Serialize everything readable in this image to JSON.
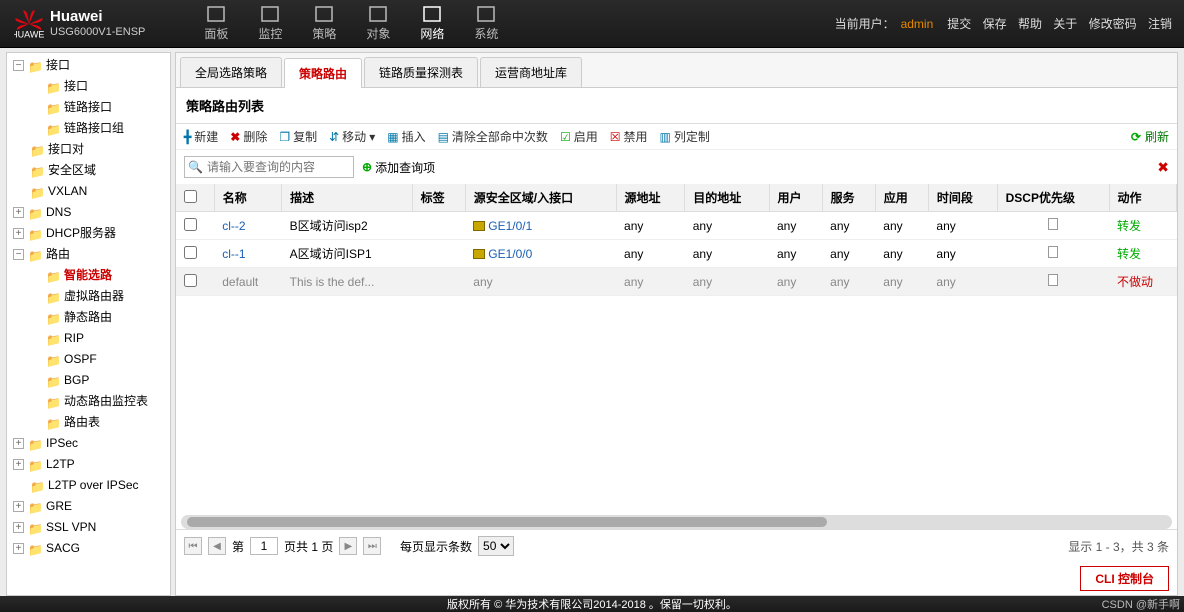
{
  "header": {
    "brand": "Huawei",
    "model": "USG6000V1-ENSP",
    "user_label": "当前用户：",
    "user_name": "admin",
    "links": [
      "提交",
      "保存",
      "帮助",
      "关于",
      "修改密码",
      "注销"
    ]
  },
  "topnav": [
    {
      "label": "面板"
    },
    {
      "label": "监控"
    },
    {
      "label": "策略"
    },
    {
      "label": "对象"
    },
    {
      "label": "网络",
      "active": true
    },
    {
      "label": "系统"
    }
  ],
  "sidebar": [
    {
      "label": "接口",
      "lvl": 1,
      "exp": "-"
    },
    {
      "label": "接口",
      "lvl": 2,
      "exp": ""
    },
    {
      "label": "链路接口",
      "lvl": 2,
      "exp": ""
    },
    {
      "label": "链路接口组",
      "lvl": 2,
      "exp": ""
    },
    {
      "label": "接口对",
      "lvl": 1,
      "exp": ""
    },
    {
      "label": "安全区域",
      "lvl": 1,
      "exp": ""
    },
    {
      "label": "VXLAN",
      "lvl": 1,
      "exp": ""
    },
    {
      "label": "DNS",
      "lvl": 1,
      "exp": "+"
    },
    {
      "label": "DHCP服务器",
      "lvl": 1,
      "exp": "+"
    },
    {
      "label": "路由",
      "lvl": 1,
      "exp": "-"
    },
    {
      "label": "智能选路",
      "lvl": 2,
      "exp": "",
      "sel": true
    },
    {
      "label": "虚拟路由器",
      "lvl": 2,
      "exp": ""
    },
    {
      "label": "静态路由",
      "lvl": 2,
      "exp": ""
    },
    {
      "label": "RIP",
      "lvl": 2,
      "exp": ""
    },
    {
      "label": "OSPF",
      "lvl": 2,
      "exp": ""
    },
    {
      "label": "BGP",
      "lvl": 2,
      "exp": ""
    },
    {
      "label": "动态路由监控表",
      "lvl": 2,
      "exp": ""
    },
    {
      "label": "路由表",
      "lvl": 2,
      "exp": ""
    },
    {
      "label": "IPSec",
      "lvl": 1,
      "exp": "+"
    },
    {
      "label": "L2TP",
      "lvl": 1,
      "exp": "+"
    },
    {
      "label": "L2TP over IPSec",
      "lvl": 1,
      "exp": ""
    },
    {
      "label": "GRE",
      "lvl": 1,
      "exp": "+"
    },
    {
      "label": "SSL VPN",
      "lvl": 1,
      "exp": "+"
    },
    {
      "label": "SACG",
      "lvl": 1,
      "exp": "+"
    }
  ],
  "subtabs": [
    {
      "label": "全局选路策略"
    },
    {
      "label": "策略路由",
      "active": true
    },
    {
      "label": "链路质量探测表"
    },
    {
      "label": "运营商地址库"
    }
  ],
  "panel_title": "策略路由列表",
  "toolbar": {
    "add": "新建",
    "del": "删除",
    "copy": "复制",
    "move": "移动",
    "insert": "插入",
    "clear": "清除全部命中次数",
    "enable": "启用",
    "disable": "禁用",
    "cols": "列定制",
    "refresh": "刷新"
  },
  "search": {
    "placeholder": "请输入要查询的内容",
    "addq": "添加查询项"
  },
  "columns": [
    "",
    "名称",
    "描述",
    "标签",
    "源安全区域/入接口",
    "源地址",
    "目的地址",
    "用户",
    "服务",
    "应用",
    "时间段",
    "DSCP优先级",
    "动作"
  ],
  "rows": [
    {
      "name": "cl--2",
      "desc": "B区域访问isp2",
      "tag": "",
      "zone": "GE1/0/1",
      "src": "any",
      "dst": "any",
      "user": "any",
      "svc": "any",
      "app": "any",
      "time": "any",
      "dscp": "",
      "action": "转发",
      "cls": "fwd"
    },
    {
      "name": "cl--1",
      "desc": "A区域访问ISP1",
      "tag": "",
      "zone": "GE1/0/0",
      "src": "any",
      "dst": "any",
      "user": "any",
      "svc": "any",
      "app": "any",
      "time": "any",
      "dscp": "",
      "action": "转发",
      "cls": "fwd"
    },
    {
      "name": "default",
      "desc": "This is the def...",
      "tag": "",
      "zone": "any",
      "src": "any",
      "dst": "any",
      "user": "any",
      "svc": "any",
      "app": "any",
      "time": "any",
      "dscp": "",
      "action": "不做动",
      "cls": "nofwd",
      "def": true
    }
  ],
  "pager": {
    "page_label": "第",
    "page": "1",
    "total_pages": "页共 1 页",
    "perpage_label": "每页显示条数",
    "perpage": "50",
    "info": "显示 1 - 3，共 3 条"
  },
  "cli": "CLI 控制台",
  "footer": "版权所有 © 华为技术有限公司2014-2018 。保留一切权利。",
  "watermark": "CSDN @新手啊"
}
